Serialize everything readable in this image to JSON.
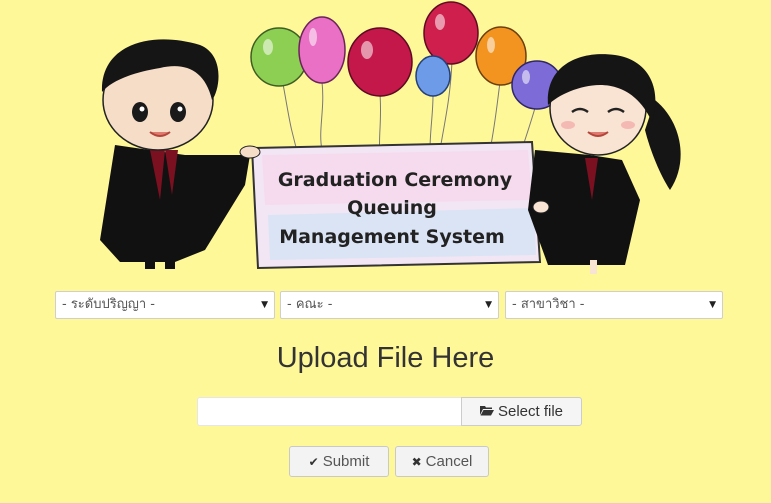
{
  "banner": {
    "line1": "Graduation Ceremony",
    "line2": "Queuing",
    "line3": "Management System"
  },
  "selects": {
    "degree": "- ระดับปริญญา -",
    "faculty": "- คณะ -",
    "major": "- สาขาวิชา -"
  },
  "upload": {
    "title": "Upload File Here",
    "select_file_label": "Select file",
    "file_value": ""
  },
  "actions": {
    "submit_label": "Submit",
    "cancel_label": "Cancel"
  },
  "colors": {
    "background": "#fff899",
    "gown": "#111111",
    "banner": "#f2e6f4"
  }
}
